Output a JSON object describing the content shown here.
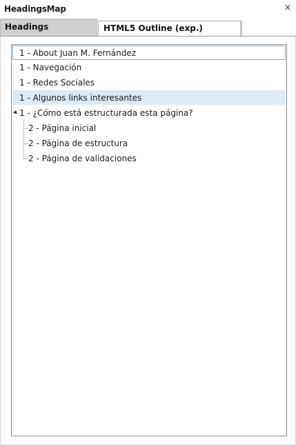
{
  "panel": {
    "title": "HeadingsMap",
    "close_glyph": "×"
  },
  "tabs": [
    {
      "label": "Headings",
      "active": true
    },
    {
      "label": "HTML5 Outline (exp.)",
      "active": false
    }
  ],
  "tree": {
    "items": [
      {
        "label": "1 - About Juan M. Fernández",
        "level": 1,
        "state": "selected"
      },
      {
        "label": "1 - Navegación",
        "level": 1,
        "state": "normal"
      },
      {
        "label": "1 - Redes Sociales",
        "level": 1,
        "state": "normal"
      },
      {
        "label": "1 - Algunos links interesantes",
        "level": 1,
        "state": "hover"
      },
      {
        "label": "1 - ¿Cómo está estructurada esta página?",
        "level": 1,
        "state": "expanded"
      },
      {
        "label": "2 - Página inicial",
        "level": 2,
        "state": "normal"
      },
      {
        "label": "2 - Página de estructura",
        "level": 2,
        "state": "normal"
      },
      {
        "label": "2 - Página de validaciones",
        "level": 2,
        "state": "normal"
      }
    ]
  },
  "colors": {
    "selection_border": "#7ea6cf",
    "hover_background": "#dde9f5",
    "active_tab_background": "#cfcfcf"
  }
}
